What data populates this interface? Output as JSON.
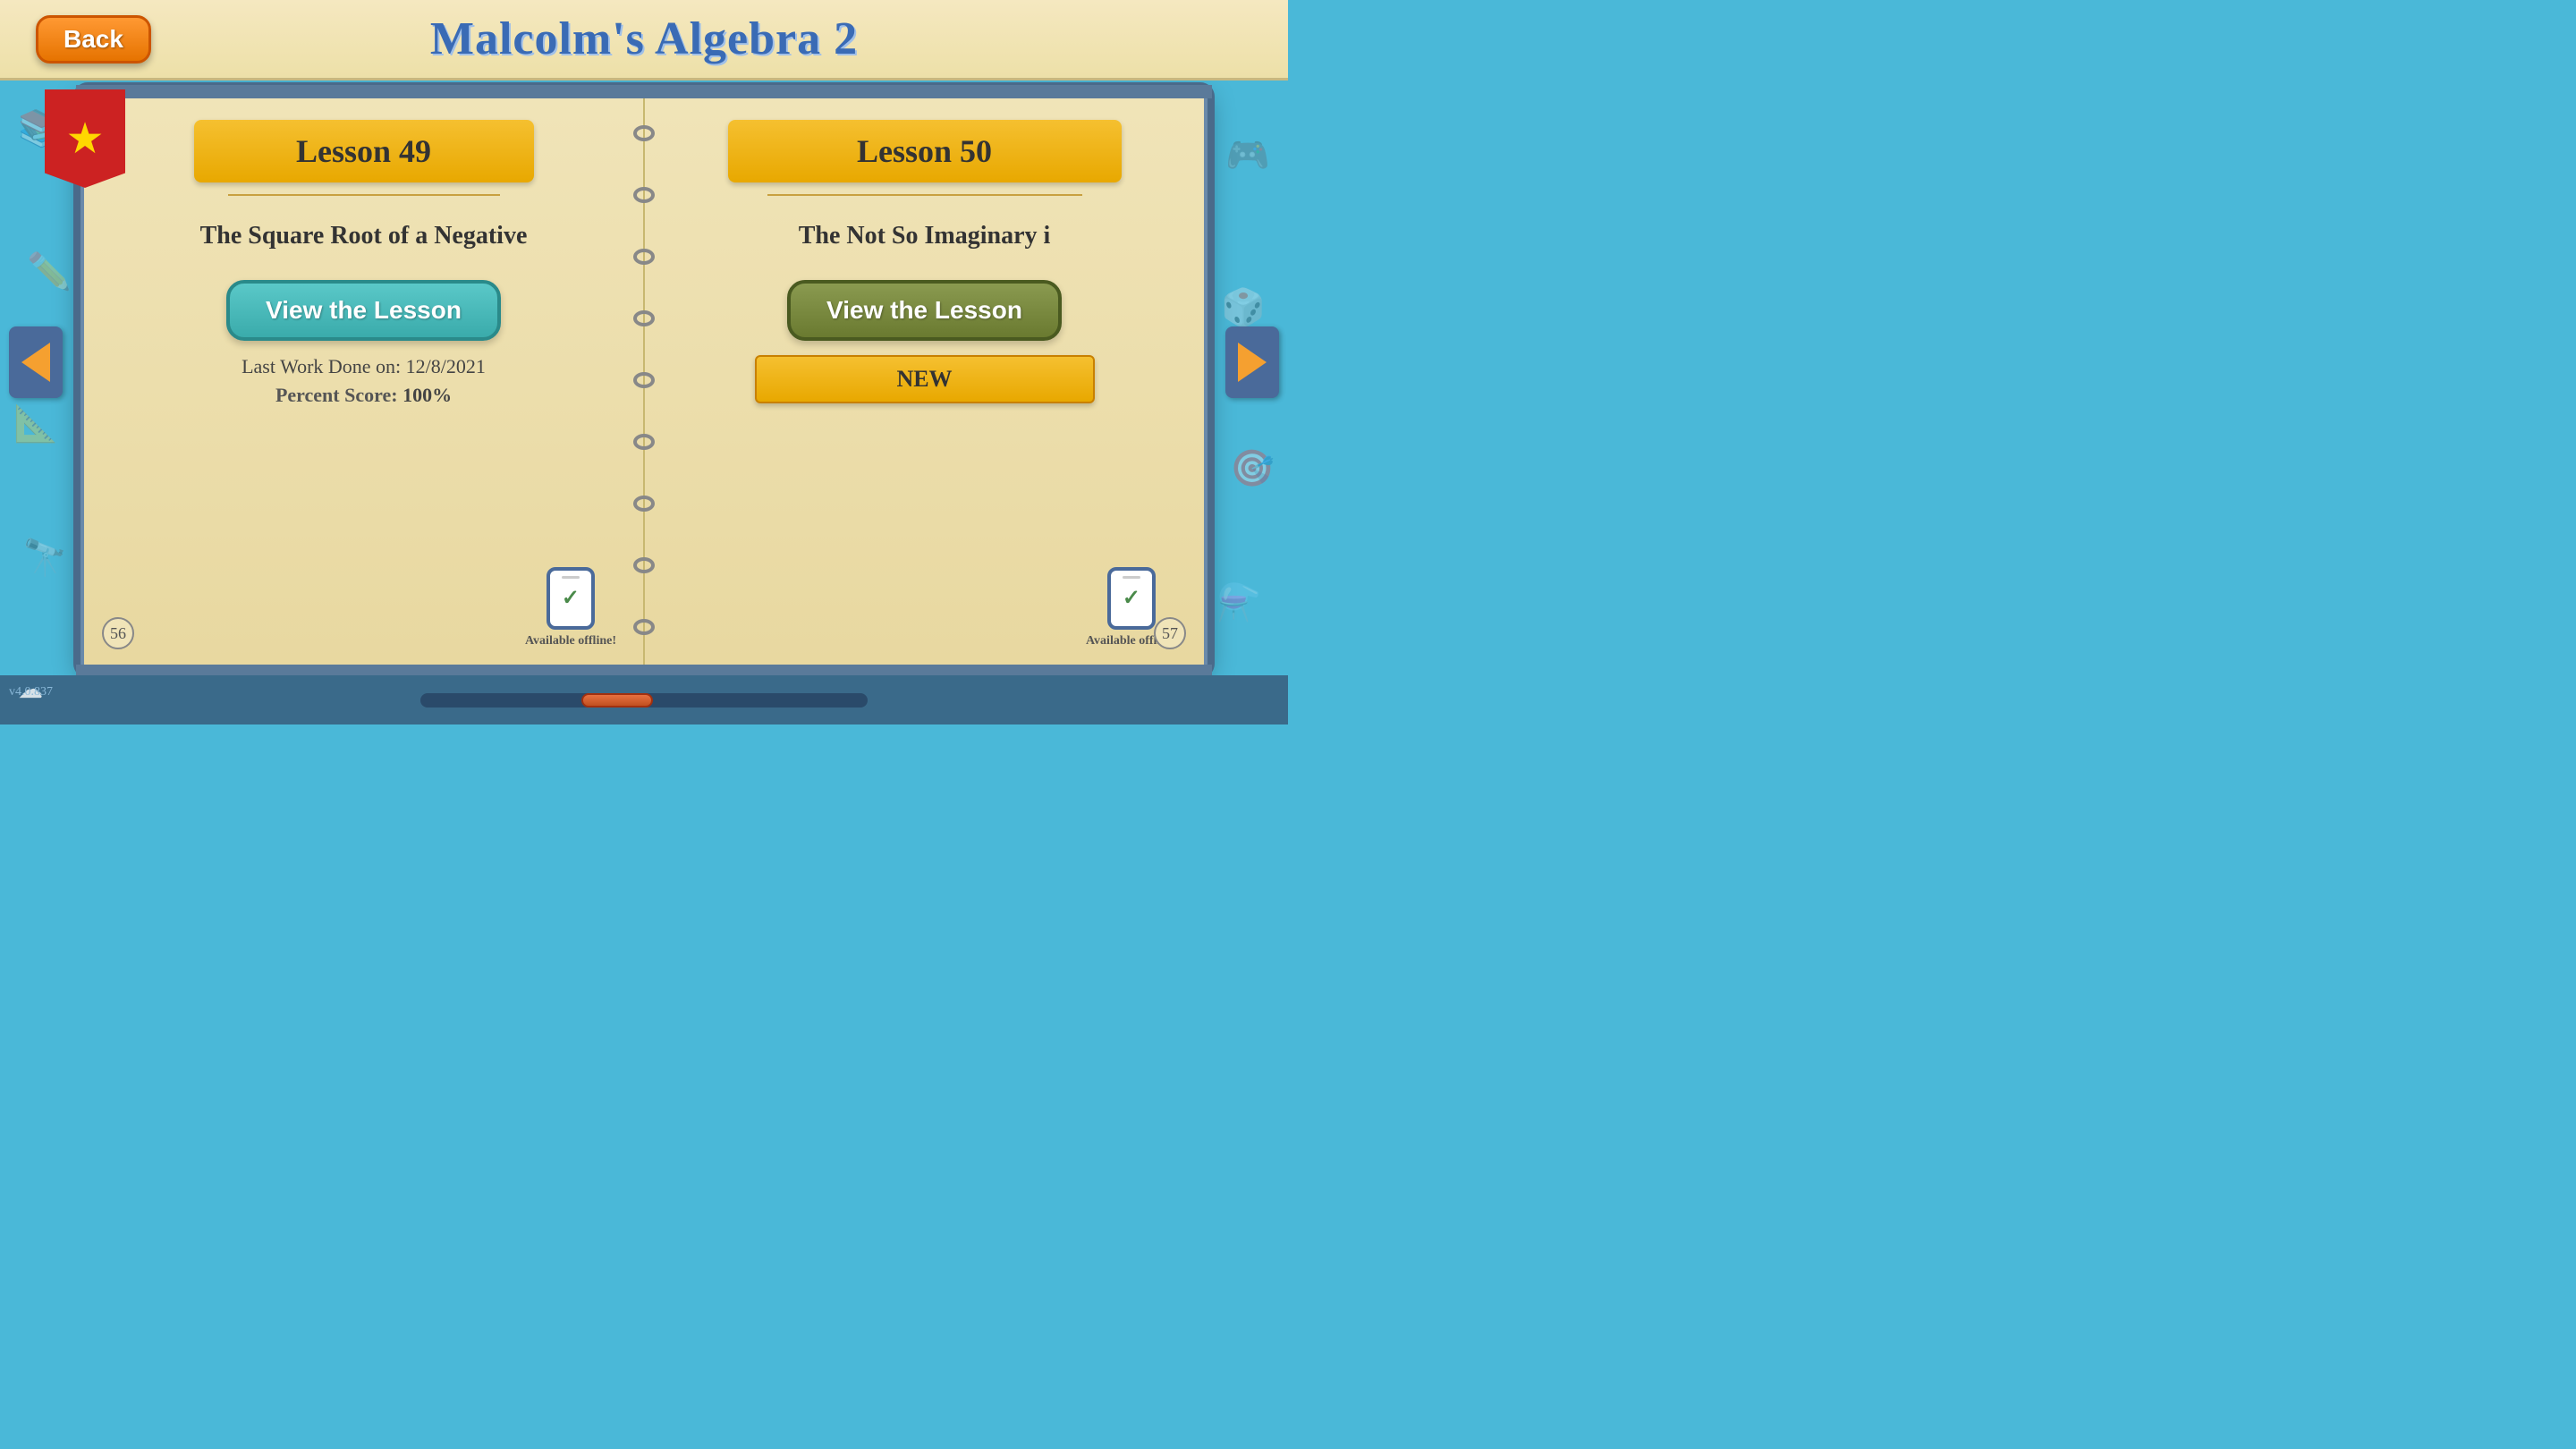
{
  "header": {
    "title": "Malcolm's Algebra 2",
    "back_label": "Back"
  },
  "left_page": {
    "lesson_number": "Lesson 49",
    "lesson_title": "The Square Root of a Negative",
    "btn_label": "View the Lesson",
    "last_work": "Last Work Done on: 12/8/2021",
    "percent_label": "Percent Score:",
    "percent_value": "100%",
    "offline_label": "Available offline!",
    "page_number": "56"
  },
  "right_page": {
    "lesson_number": "Lesson 50",
    "lesson_title": "The Not So Imaginary i",
    "btn_label": "View the Lesson",
    "new_badge": "NEW",
    "offline_label": "Available offline!",
    "page_number": "57"
  },
  "nav": {
    "prev_label": "◀",
    "next_label": "▶"
  },
  "version": "v4.0.837"
}
